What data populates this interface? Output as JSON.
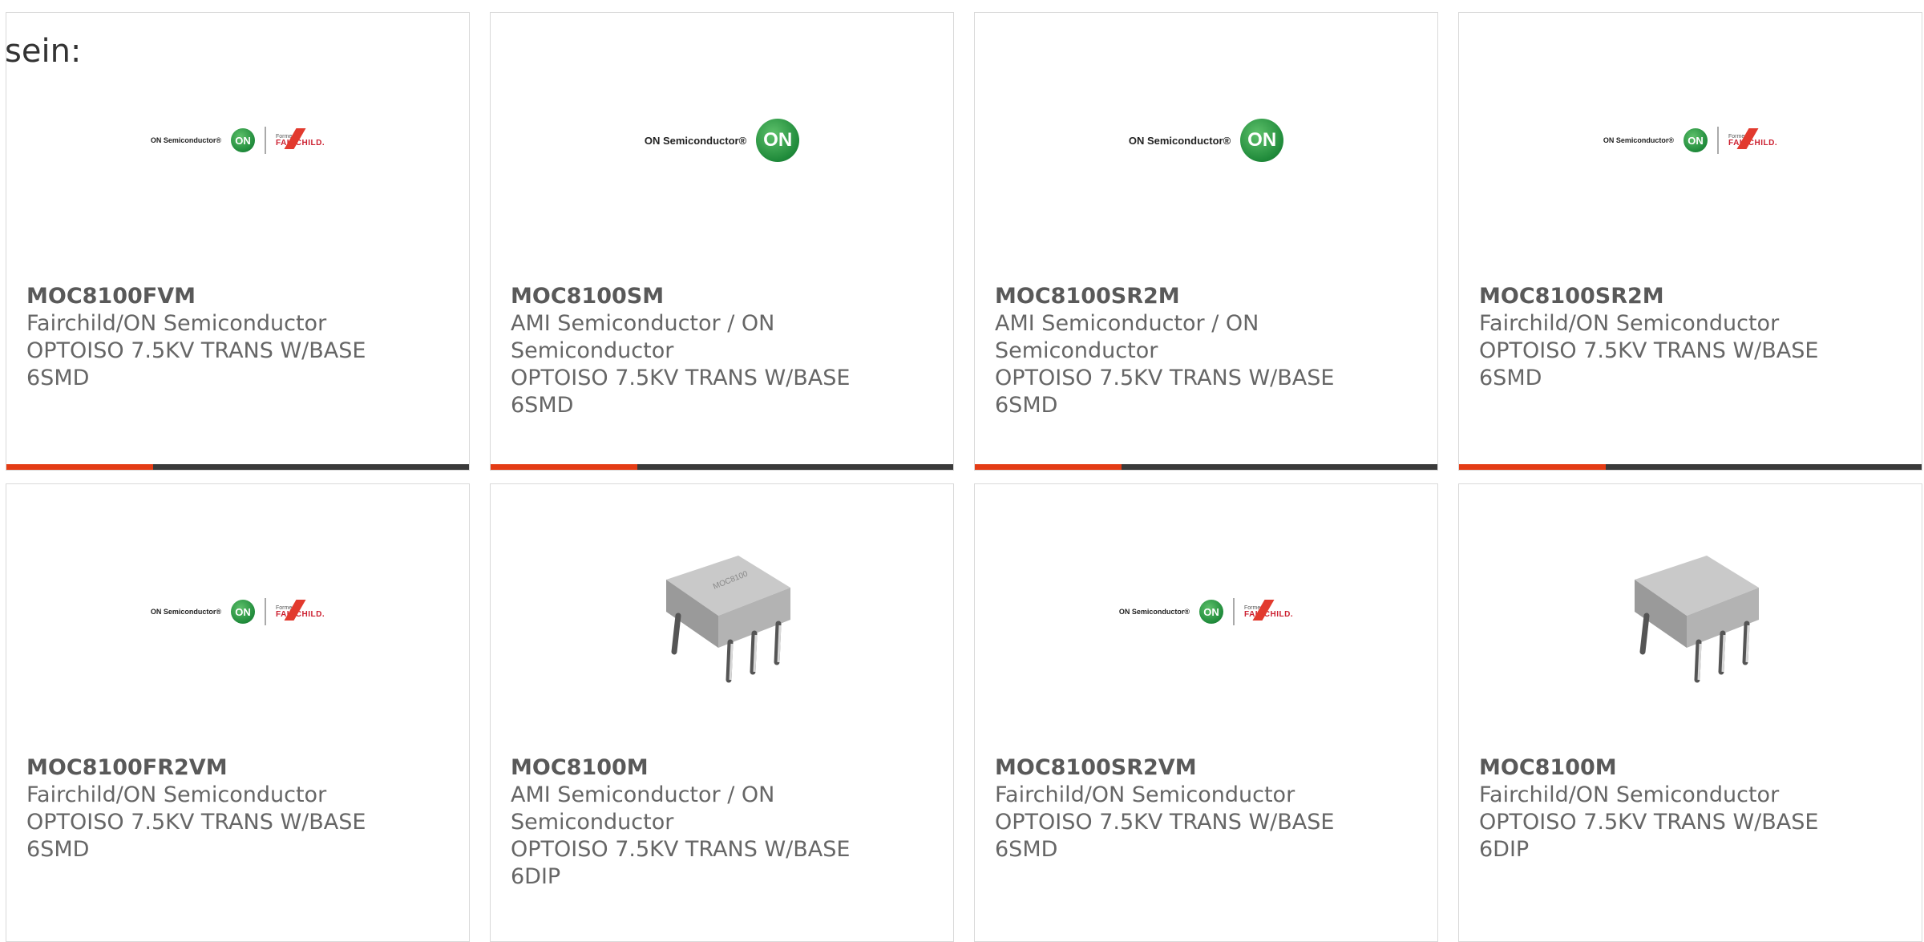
{
  "intro_text": "sein:",
  "colors": {
    "accent": "#e43c15",
    "bar": "#3a3a3a",
    "on_green": "#1f8a3a",
    "fairchild_red": "#e23a2e"
  },
  "logos": {
    "on_semi": {
      "text": "ON Semiconductor®",
      "circle": "ON"
    },
    "fairchild": {
      "formerly": "Formerly",
      "word": "FAIRCHILD."
    }
  },
  "products": [
    {
      "image": "on-fairchild-logo",
      "part": "MOC8100FVM",
      "manufacturer": "Fairchild/ON Semiconductor",
      "description": "OPTOISO 7.5KV TRANS W/BASE 6SMD"
    },
    {
      "image": "on-semi-logo",
      "part": "MOC8100SM",
      "manufacturer": "AMI Semiconductor / ON Semiconductor",
      "description": "OPTOISO 7.5KV TRANS W/BASE 6SMD"
    },
    {
      "image": "on-semi-logo",
      "part": "MOC8100SR2M",
      "manufacturer": "AMI Semiconductor / ON Semiconductor",
      "description": "OPTOISO 7.5KV TRANS W/BASE 6SMD"
    },
    {
      "image": "on-fairchild-logo",
      "part": "MOC8100SR2M",
      "manufacturer": "Fairchild/ON Semiconductor",
      "description": "OPTOISO 7.5KV TRANS W/BASE 6SMD"
    },
    {
      "image": "on-fairchild-logo",
      "part": "MOC8100FR2VM",
      "manufacturer": "Fairchild/ON Semiconductor",
      "description": "OPTOISO 7.5KV TRANS W/BASE 6SMD"
    },
    {
      "image": "dip6-chip-photo",
      "part": "MOC8100M",
      "manufacturer": "AMI Semiconductor / ON Semiconductor",
      "description": "OPTOISO 7.5KV TRANS W/BASE 6DIP"
    },
    {
      "image": "on-fairchild-logo",
      "part": "MOC8100SR2VM",
      "manufacturer": "Fairchild/ON Semiconductor",
      "description": "OPTOISO 7.5KV TRANS W/BASE 6SMD"
    },
    {
      "image": "dip6-chip-photo",
      "part": "MOC8100M",
      "manufacturer": "Fairchild/ON Semiconductor",
      "description": "OPTOISO 7.5KV TRANS W/BASE 6DIP"
    }
  ]
}
